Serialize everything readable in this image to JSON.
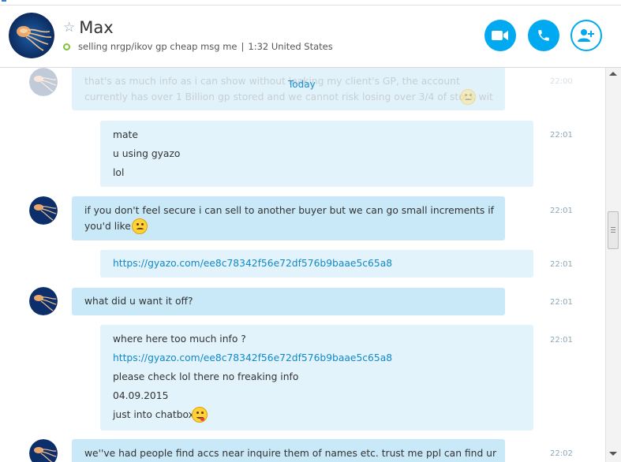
{
  "contact": {
    "name": "Max",
    "mood": "selling nrgp/ikov gp cheap msg me",
    "separator": "|",
    "local_time": "1:32 United States"
  },
  "icons": {
    "favorite": "star-icon",
    "presence": "online-status-icon",
    "video": "video-call-icon",
    "call": "phone-icon",
    "add": "add-contact-icon"
  },
  "colors": {
    "accent": "#00a9f0",
    "incoming_bubble": "#c9e9f8",
    "outgoing_bubble": "#e2f3fb",
    "link": "#1189c7",
    "online": "#7ec23b"
  },
  "chat": {
    "day_divider": "Today",
    "partial_top": {
      "line1": "that's as much info as i can show without leaking my client's GP, the account",
      "line2": "currently has over 1 Billion gp stored and we cannot risk losing over 3/4 of stock wit",
      "time": "22:00"
    },
    "messages": [
      {
        "lines": [
          "mate",
          "u using gyazo",
          "lol"
        ],
        "time": "22:01"
      },
      {
        "lines": [
          "if you don't feel secure i can sell to another buyer but we can go small increments if",
          "you'd like"
        ],
        "time": "22:01"
      },
      {
        "lines": [
          "https://gyazo.com/ee8c78342f56e72df576b9baae5c65a8"
        ],
        "time": "22:01"
      },
      {
        "lines": [
          "what did u want it off?"
        ],
        "time": "22:01"
      },
      {
        "lines": [
          "where here too much info ?",
          "https://gyazo.com/ee8c78342f56e72df576b9baae5c65a8",
          "please check lol there no freaking info",
          "04.09.2015",
          "just into chatbox"
        ],
        "time": "22:01"
      },
      {
        "lines": [
          "we''ve had people find accs near inquire them of names etc. trust me ppl can find ur"
        ],
        "time": "22:02"
      }
    ]
  }
}
